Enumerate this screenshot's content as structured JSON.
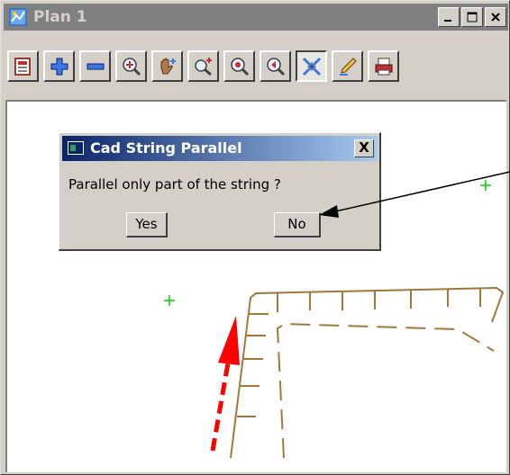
{
  "window": {
    "title": "Plan 1",
    "minimize_glyph": "_",
    "maximize_glyph": "□",
    "close_glyph": "✕"
  },
  "toolbar": {
    "tools": [
      {
        "name": "plot-icon"
      },
      {
        "name": "zoom-in-plus-icon"
      },
      {
        "name": "zoom-out-minus-icon"
      },
      {
        "name": "zoom-magnifier-icon"
      },
      {
        "name": "pan-hand-icon"
      },
      {
        "name": "zoom-box-icon"
      },
      {
        "name": "zoom-extents-icon"
      },
      {
        "name": "zoom-previous-icon"
      },
      {
        "name": "cursor-cross-icon",
        "pressed": true
      },
      {
        "name": "pen-icon"
      },
      {
        "name": "print-icon"
      }
    ]
  },
  "dialog": {
    "title": "Cad String Parallel",
    "close_label": "X",
    "message": "Parallel only part of the string ?",
    "yes_label": "Yes",
    "no_label": "No"
  },
  "colors": {
    "title_inactive": "#808080",
    "dialog_title": "#0a246a",
    "string_brown": "#a0783c",
    "marker_green": "#00d000",
    "arrow_red": "#ff0000"
  }
}
